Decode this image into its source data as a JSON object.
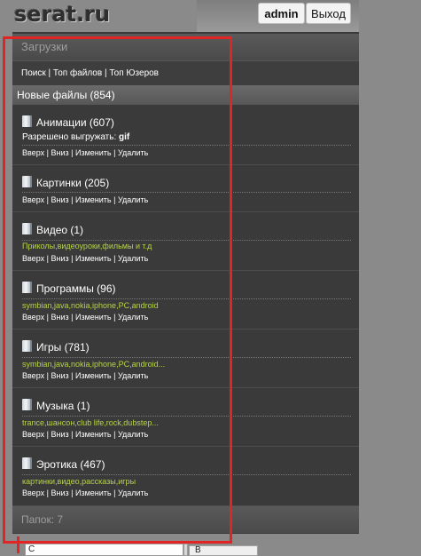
{
  "logo": "serat.ru",
  "user": {
    "admin_label": "admin",
    "logout_label": "Выход"
  },
  "section_title": "Загрузки",
  "nav_links": {
    "search": "Поиск",
    "top_files": "Топ файлов",
    "top_users": "Топ Юзеров",
    "separator": "|"
  },
  "new_files": "Новые файлы (854)",
  "actions": {
    "up": "Вверх",
    "down": "Вниз",
    "edit": "Изменить",
    "delete": "Удалить",
    "separator": "|"
  },
  "categories": [
    {
      "title": "Анимации (607)",
      "desc_prefix": "Разрешено выгружать: ",
      "desc_bold": "gif"
    },
    {
      "title": "Картинки (205)"
    },
    {
      "title": "Видео (1)",
      "desc": "Приколы,видеоуроки,фильмы и т.д"
    },
    {
      "title": "Программы (96)",
      "desc": "symbian,java,nokia,iphone,PC,android"
    },
    {
      "title": "Игры (781)",
      "desc": "symbian,java,nokia,iphone,PC,android..."
    },
    {
      "title": "Музыка (1)",
      "desc": "trance,шансон,club life,rock,dubstep..."
    },
    {
      "title": "Эротика (467)",
      "desc": "картинки,видео,рассказы,игры"
    }
  ],
  "folders_count": "Папок: 7",
  "bottom": {
    "input_value": "С",
    "button_label": "В"
  },
  "colors": {
    "accent_desc": "#b7d34a",
    "highlight_box": "#e32424",
    "panel_bg": "#3a3a3a"
  },
  "icons": {
    "category": "folder-icon"
  }
}
